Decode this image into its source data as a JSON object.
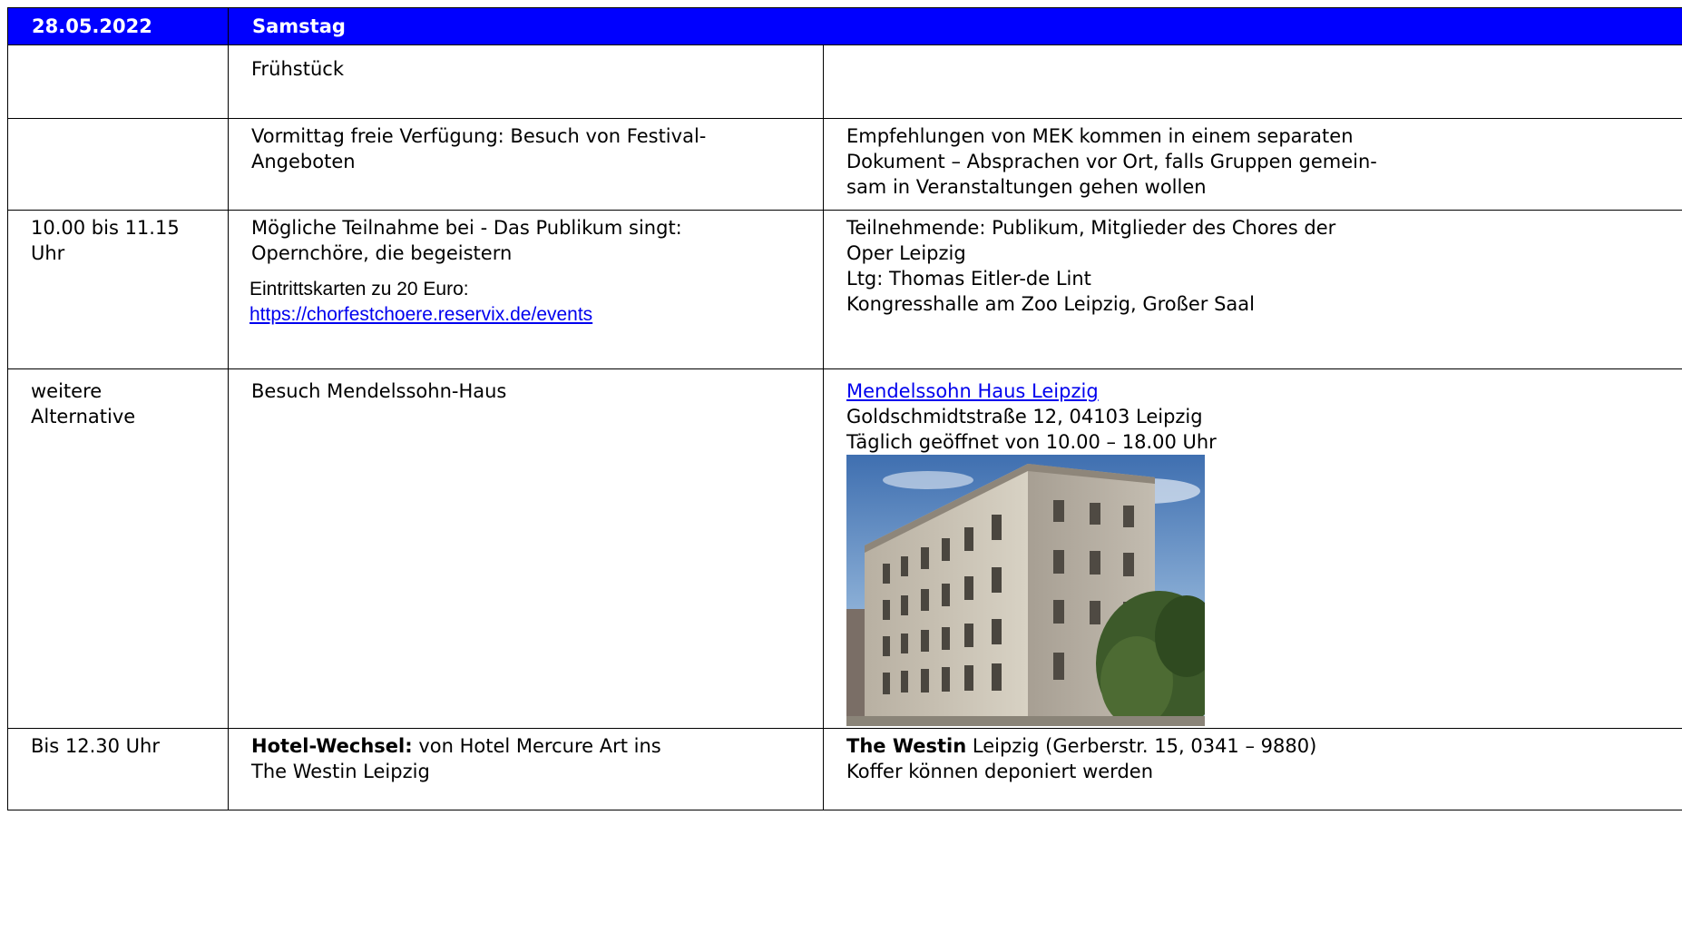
{
  "header": {
    "date": "28.05.2022",
    "day": "Samstag"
  },
  "rows": [
    {
      "time": "",
      "activity": "Frühstück",
      "notes": ""
    },
    {
      "time": "",
      "activity_lines": [
        "Vormittag freie Verfügung: Besuch von Festival-",
        "Angeboten"
      ],
      "notes_lines": [
        "Empfehlungen von MEK kommen in einem separaten",
        "Dokument – Absprachen vor Ort, falls Gruppen gemein-",
        "sam in Veranstaltungen gehen wollen"
      ]
    },
    {
      "time_lines": [
        "10.00 bis 11.15",
        "Uhr"
      ],
      "activity_lines": [
        "Mögliche Teilnahme bei - Das Publikum singt:",
        "Opernchöre, die begeistern"
      ],
      "tickets_label": "Eintrittskarten zu 20 Euro:",
      "tickets_link": "https://chorfestchoere.reservix.de/events",
      "notes_lines": [
        "Teilnehmende: Publikum, Mitglieder des Chores der",
        "Oper Leipzig",
        "Ltg: Thomas Eitler-de Lint",
        "Kongresshalle am Zoo Leipzig, Großer Saal"
      ]
    },
    {
      "time_lines": [
        "weitere",
        "Alternative"
      ],
      "activity": "Besuch Mendelssohn-Haus",
      "link_text": "Mendelssohn Haus Leipzig",
      "notes_lines": [
        "Goldschmidtstraße 12, 04103 Leipzig",
        "Täglich geöffnet von 10.00 – 18.00 Uhr"
      ]
    },
    {
      "time": "Bis 12.30 Uhr",
      "activity_bold": "Hotel-Wechsel:",
      "activity_rest": " von Hotel Mercure Art ins",
      "activity_line2": "The Westin Leipzig",
      "notes_bold": "The Westin",
      "notes_rest": " Leipzig (Gerberstr. 15, 0341 – 9880)",
      "notes_line2": "Koffer können deponiert werden"
    }
  ]
}
